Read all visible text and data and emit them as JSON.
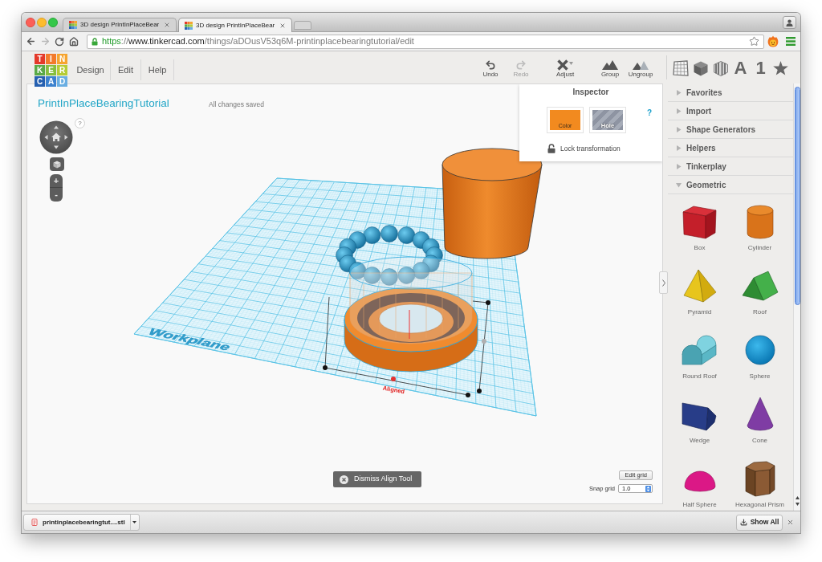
{
  "browser": {
    "tabs": [
      {
        "title": "3D design PrintInPlaceBear",
        "selected": false
      },
      {
        "title": "3D design PrintInPlaceBear",
        "selected": true
      }
    ],
    "nav_buttons": [
      {
        "kind": "back",
        "disabled": false
      },
      {
        "kind": "forward",
        "disabled": true
      },
      {
        "kind": "reload",
        "disabled": false
      },
      {
        "kind": "home",
        "disabled": false
      }
    ],
    "address": [
      {
        "kind": "scheme",
        "text": "https"
      },
      {
        "kind": "plain",
        "text": "://"
      },
      {
        "kind": "host",
        "text": "www.tinkercad.com"
      },
      {
        "kind": "plain",
        "text": "/things/aDOusV53q6M-printinplacebearingtutorial/edit"
      }
    ]
  },
  "header": {
    "logo": [
      {
        "letter": "T",
        "color": "#e4392a"
      },
      {
        "letter": "I",
        "color": "#f37a2b"
      },
      {
        "letter": "N",
        "color": "#f6a42f"
      },
      {
        "letter": "K",
        "color": "#5aaa47"
      },
      {
        "letter": "E",
        "color": "#86bf3f"
      },
      {
        "letter": "R",
        "color": "#b5cc35"
      },
      {
        "letter": "C",
        "color": "#2660b0"
      },
      {
        "letter": "A",
        "color": "#3c82cf"
      },
      {
        "letter": "D",
        "color": "#6aaee2"
      }
    ],
    "menu": [
      "Design",
      "Edit",
      "Help"
    ],
    "tools": [
      {
        "kind": "undo",
        "label": "Undo",
        "disabled": false
      },
      {
        "kind": "redo",
        "label": "Redo",
        "disabled": true
      },
      {
        "kind": "adjust",
        "label": "Adjust",
        "disabled": false
      },
      {
        "kind": "group",
        "label": "Group",
        "disabled": false
      },
      {
        "kind": "ungroup",
        "label": "Ungroup",
        "disabled": false
      }
    ],
    "panel_tabs": [
      {
        "kind": "grid"
      },
      {
        "kind": "solid"
      },
      {
        "kind": "striped"
      },
      {
        "kind": "text",
        "label": "A"
      },
      {
        "kind": "text",
        "label": "1"
      },
      {
        "kind": "star"
      }
    ]
  },
  "canvas": {
    "title": "PrintInPlaceBearingTutorial",
    "save_status": "All changes saved",
    "view_help": "?",
    "zoom_in": "+",
    "zoom_out": "-",
    "workplane_label": "Workplane",
    "align_label": "Aligned",
    "inspector": {
      "title": "Inspector",
      "swatches": [
        {
          "kind": "color",
          "label": "Color"
        },
        {
          "kind": "hole",
          "label": "Hole"
        }
      ],
      "help": "?",
      "lock_label": "Lock transformation",
      "locked": false
    },
    "dismiss_button": "Dismiss Align Tool",
    "edit_grid_button": "Edit grid",
    "snap_grid": {
      "label": "Snap grid",
      "value": "1.0"
    }
  },
  "library": {
    "sections": [
      {
        "label": "Favorites",
        "expanded": false
      },
      {
        "label": "Import",
        "expanded": false
      },
      {
        "label": "Shape Generators",
        "expanded": false
      },
      {
        "label": "Helpers",
        "expanded": false
      },
      {
        "label": "Tinkerplay",
        "expanded": false
      },
      {
        "label": "Geometric",
        "expanded": true,
        "shapes": [
          {
            "kind": "box",
            "label": "Box"
          },
          {
            "kind": "cylinder",
            "label": "Cylinder"
          },
          {
            "kind": "pyramid",
            "label": "Pyramid"
          },
          {
            "kind": "roof",
            "label": "Roof"
          },
          {
            "kind": "round_roof",
            "label": "Round Roof"
          },
          {
            "kind": "sphere",
            "label": "Sphere"
          },
          {
            "kind": "wedge",
            "label": "Wedge"
          },
          {
            "kind": "cone",
            "label": "Cone"
          },
          {
            "kind": "half_sphere",
            "label": "Half Sphere"
          },
          {
            "kind": "hexagonal_prism",
            "label": "Hexagonal Prism"
          }
        ]
      }
    ]
  },
  "downloads": {
    "file": "printinplacebearingtut....stl",
    "show_all": "Show All"
  }
}
